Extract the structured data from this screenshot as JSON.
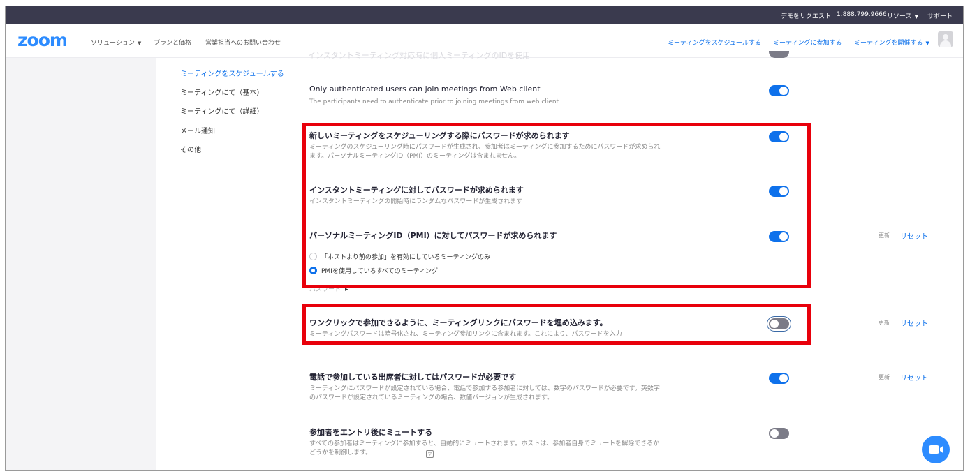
{
  "topbar": {
    "request_demo": "デモをリクエスト",
    "phone": "1.888.799.9666",
    "resources": "リソース",
    "support": "サポート"
  },
  "nav": {
    "logo": "zoom",
    "solutions": "ソリューション",
    "pricing": "プランと価格",
    "contact_sales": "営業担当へのお問い合わせ",
    "schedule": "ミーティングをスケジュールする",
    "join": "ミーティングに参加する",
    "host": "ミーティングを開催する"
  },
  "ghost_heading": "インスタントミーティング対応時に個人ミーティングのIDを使用",
  "subnav": [
    {
      "label": "ミーティングをスケジュールする",
      "active": true
    },
    {
      "label": "ミーティングにて（基本）"
    },
    {
      "label": "ミーティングにて（詳細）"
    },
    {
      "label": "メール通知"
    },
    {
      "label": "その他"
    }
  ],
  "settings": {
    "auth_web": {
      "title": "Only authenticated users can join meetings from Web client",
      "desc": "The participants need to authenticate prior to joining meetings from web client",
      "enabled": true
    },
    "pw_schedule": {
      "title": "新しいミーティングをスケジューリングする際にパスワードが求められます",
      "desc": "ミーティングのスケジューリング時にパスワードが生成され、参加者はミーティングに参加するためにパスワードが求められます。パーソナルミーティングID（PMI）のミーティングは含まれません。",
      "enabled": true
    },
    "pw_instant": {
      "title": "インスタントミーティングに対してパスワードが求められます",
      "desc": "インスタントミーティングの開始時にランダムなパスワードが生成されます",
      "enabled": true
    },
    "pw_pmi": {
      "title": "パーソナルミーティングID（PMI）に対してパスワードが求められます",
      "enabled": true,
      "radio_1": "「ホストより前の参加」を有効にしているミーティングのみ",
      "radio_2": "PMIを使用しているすべてのミーティング",
      "selected": "radio_2",
      "partial_link": "パスワード"
    },
    "pw_embed": {
      "title": "ワンクリックで参加できるように、ミーティングリンクにパスワードを埋め込みます。",
      "desc": "ミーティングパスワードは暗号化され、ミーティング参加リンクに含まれます。これにより、パスワードを入力",
      "enabled": false
    },
    "pw_phone": {
      "title": "電話で参加している出席者に対してはパスワードが必要です",
      "desc": "ミーティングにパスワードが設定されている場合、電話で参加する参加者に対しては、数字のパスワードが必要です。英数字のパスワードが設定されているミーティングの場合、数値バージョンが生成されます。",
      "enabled": true
    },
    "mute_entry": {
      "title": "参加者をエントリ後にミュートする",
      "desc": "すべての参加者はミーティングに参加すると、自動的にミュートされます。ホストは、参加者自身でミュートを解除できるかどうかを制御します。",
      "enabled": false
    }
  },
  "row_actions": {
    "updated": "更新",
    "reset": "リセット"
  },
  "colors": {
    "accent": "#0e71eb",
    "highlight": "#e8000b",
    "topbar": "#3a3a4e"
  }
}
